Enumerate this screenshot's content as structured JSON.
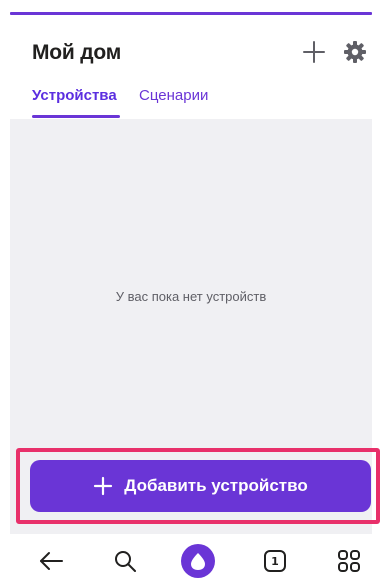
{
  "header": {
    "title": "Мой дом"
  },
  "tabs": [
    {
      "label": "Устройства",
      "active": true
    },
    {
      "label": "Сценарии",
      "active": false
    }
  ],
  "main": {
    "empty_message": "У вас пока нет устройств"
  },
  "add_device": {
    "label": "Добавить устройство"
  },
  "bottom_nav": {
    "tabs_count": "1",
    "items": [
      "back-arrow-icon",
      "search-icon",
      "alice-icon",
      "tabs-icon",
      "apps-grid-icon"
    ]
  },
  "colors": {
    "accent": "#6a35d6",
    "highlight": "#e8306a",
    "content_bg": "#f0f0f3"
  }
}
